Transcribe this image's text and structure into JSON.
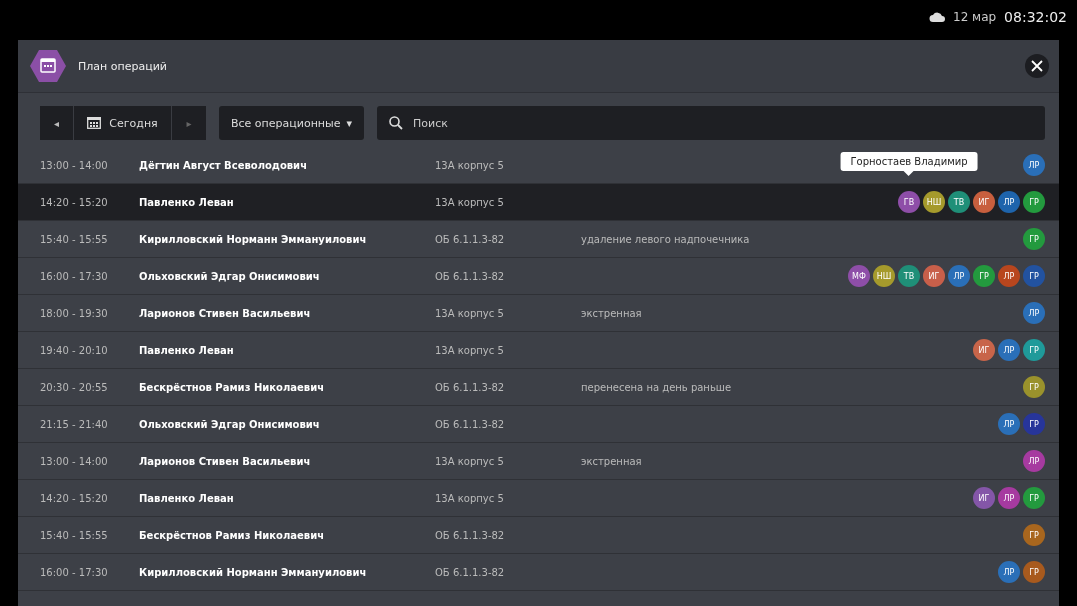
{
  "status_bar": {
    "date": "12 мар",
    "time": "08:32:02"
  },
  "window": {
    "title": "План операций"
  },
  "toolbar": {
    "prev": "◂",
    "today": "Сегодня",
    "next": "▸",
    "filter": "Все операционные",
    "filter_caret": "▾",
    "search": {
      "placeholder": "Поиск"
    }
  },
  "rows": [
    {
      "time": "13:00 - 14:00",
      "name": "Дёгтин Август Всеволодович",
      "location": "13А корпус 5",
      "selected": false,
      "avatars": [
        {
          "initials": "ЛР",
          "color": "#2a6fb8"
        }
      ]
    },
    {
      "time": "14:20 - 15:20",
      "name": "Павленко Леван",
      "location": "13А корпус 5",
      "selected": true,
      "avatars": [
        {
          "initials": "ГВ",
          "color": "#8e4ea8",
          "tooltip": "Горностаев Владимир"
        },
        {
          "initials": "НШ",
          "color": "#a59a2c"
        },
        {
          "initials": "ТВ",
          "color": "#1f8f78"
        },
        {
          "initials": "ИГ",
          "color": "#c85f3e"
        },
        {
          "initials": "ЛР",
          "color": "#1e64ac"
        },
        {
          "initials": "ГР",
          "color": "#239a3e"
        }
      ]
    },
    {
      "time": "15:40 - 15:55",
      "name": "Кирилловский Норманн Эммануилович",
      "location": "ОБ 6.1.1.3-82",
      "note": "удаление левого надпочечника",
      "selected": false,
      "avatars": [
        {
          "initials": "ГР",
          "color": "#239a3e"
        }
      ]
    },
    {
      "time": "16:00 - 17:30",
      "name": "Ольховский Эдгар Онисимович",
      "location": "ОБ 6.1.1.3-82",
      "selected": false,
      "avatars": [
        {
          "initials": "МФ",
          "color": "#8e4ea8"
        },
        {
          "initials": "НШ",
          "color": "#a59a2c"
        },
        {
          "initials": "ТВ",
          "color": "#1f8f78"
        },
        {
          "initials": "ИГ",
          "color": "#c85f4a"
        },
        {
          "initials": "ЛР",
          "color": "#2a6fb8"
        },
        {
          "initials": "ГР",
          "color": "#239a3e"
        },
        {
          "initials": "ЛР",
          "color": "#b8461e"
        },
        {
          "initials": "ГР",
          "color": "#2252a0"
        }
      ]
    },
    {
      "time": "18:00 - 19:30",
      "name": "Ларионов Стивен Васильевич",
      "location": "13А корпус 5",
      "note": "экстренная",
      "selected": false,
      "avatars": [
        {
          "initials": "ЛР",
          "color": "#2a6fb8"
        }
      ]
    },
    {
      "time": "19:40 - 20:10",
      "name": "Павленко Леван",
      "location": "13А корпус 5",
      "selected": false,
      "avatars": [
        {
          "initials": "ИГ",
          "color": "#c8654a"
        },
        {
          "initials": "ЛР",
          "color": "#2a6fb8"
        },
        {
          "initials": "ГР",
          "color": "#1f9a9a"
        }
      ]
    },
    {
      "time": "20:30 - 20:55",
      "name": "Бескрёстнов Рамиз Николаевич",
      "location": "ОБ 6.1.1.3-82",
      "note": "перенесена на день раньше",
      "selected": false,
      "avatars": [
        {
          "initials": "ГР",
          "color": "#9a922c"
        }
      ]
    },
    {
      "time": "21:15 - 21:40",
      "name": "Ольховский Эдгар Онисимович",
      "location": "ОБ 6.1.1.3-82",
      "selected": false,
      "avatars": [
        {
          "initials": "ЛР",
          "color": "#2a6fb8"
        },
        {
          "initials": "ГР",
          "color": "#27359a"
        }
      ]
    },
    {
      "time": "13:00 - 14:00",
      "name": "Ларионов Стивен Васильевич",
      "location": "13А корпус 5",
      "note": "экстренная",
      "selected": false,
      "avatars": [
        {
          "initials": "ЛР",
          "color": "#a63aa0"
        }
      ]
    },
    {
      "time": "14:20 - 15:20",
      "name": "Павленко Леван",
      "location": "13А корпус 5",
      "selected": false,
      "avatars": [
        {
          "initials": "ИГ",
          "color": "#8456a8"
        },
        {
          "initials": "ЛР",
          "color": "#a63aa0"
        },
        {
          "initials": "ГР",
          "color": "#239a3e"
        }
      ]
    },
    {
      "time": "15:40 - 15:55",
      "name": "Бескрёстнов Рамиз Николаевич",
      "location": "ОБ 6.1.1.3-82",
      "selected": false,
      "avatars": [
        {
          "initials": "ГР",
          "color": "#a8661e"
        }
      ]
    },
    {
      "time": "16:00 - 17:30",
      "name": "Кирилловский Норманн Эммануилович",
      "location": "ОБ 6.1.1.3-82",
      "selected": false,
      "avatars": [
        {
          "initials": "ЛР",
          "color": "#2a6fb8"
        },
        {
          "initials": "ГР",
          "color": "#a85a1e"
        }
      ]
    }
  ]
}
